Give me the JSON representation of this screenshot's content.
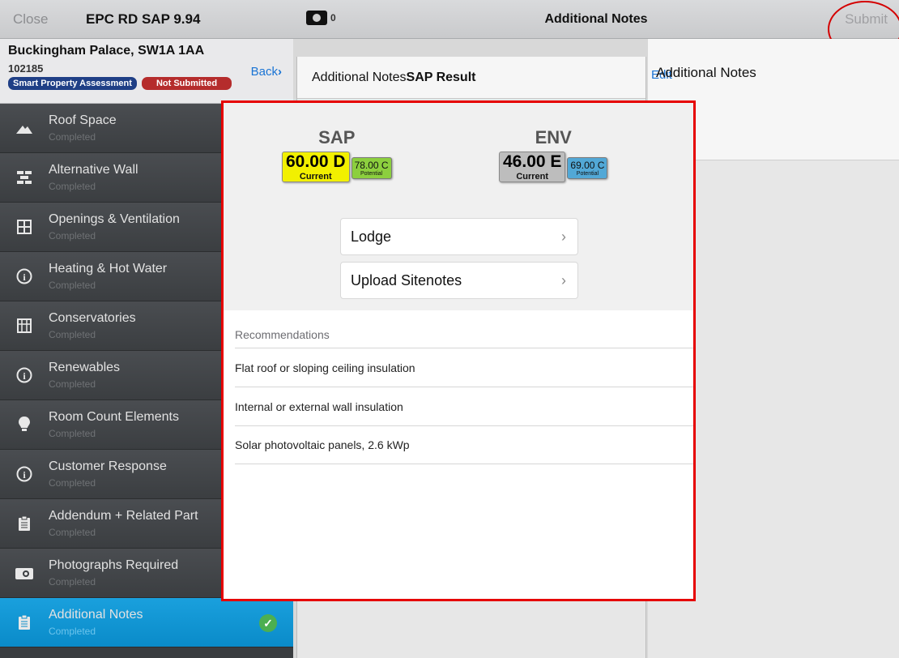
{
  "sidebar": {
    "close_label": "Close",
    "app_title": "EPC RD SAP 9.94",
    "address": "Buckingham Palace, SW1A 1AA",
    "reference": "102185",
    "back_label": "Back",
    "badge_type": "Smart Property Assessment",
    "badge_status": "Not Submitted",
    "items": [
      {
        "label": "Roof Space",
        "status": "Completed",
        "icon": "roof-icon"
      },
      {
        "label": "Alternative Wall",
        "status": "Completed",
        "icon": "brick-wall-icon"
      },
      {
        "label": "Openings & Ventilation",
        "status": "Completed",
        "icon": "window-icon"
      },
      {
        "label": "Heating & Hot Water",
        "status": "Completed",
        "icon": "info-icon"
      },
      {
        "label": "Conservatories",
        "status": "Completed",
        "icon": "conservatory-icon"
      },
      {
        "label": "Renewables",
        "status": "Completed",
        "icon": "info-icon"
      },
      {
        "label": "Room Count Elements",
        "status": "Completed",
        "icon": "bulb-icon"
      },
      {
        "label": "Customer Response",
        "status": "Completed",
        "icon": "info-icon"
      },
      {
        "label": "Addendum + Related Part",
        "status": "Completed",
        "icon": "clipboard-icon"
      },
      {
        "label": "Photographs Required",
        "status": "Completed",
        "icon": "camera-icon"
      },
      {
        "label": "Additional Notes",
        "status": "Completed",
        "icon": "clipboard-icon"
      }
    ]
  },
  "header": {
    "photo_count": "0",
    "title": "Additional Notes",
    "submit_label": "Submit"
  },
  "left_pane": {
    "title_a": "Additional Notes",
    "title_b": "SAP Result"
  },
  "right_pane": {
    "edit_label": "Edit",
    "title": "Additional Notes"
  },
  "modal": {
    "sap": {
      "title": "SAP",
      "current_value": "60.00 D",
      "current_caption": "Current",
      "potential_value": "78.00 C",
      "potential_caption": "Potential"
    },
    "env": {
      "title": "ENV",
      "current_value": "46.00 E",
      "current_caption": "Current",
      "potential_value": "69.00 C",
      "potential_caption": "Potential"
    },
    "actions": {
      "lodge": "Lodge",
      "upload": "Upload Sitenotes"
    },
    "recommendations_header": "Recommendations",
    "recommendations": [
      "Flat roof or sloping ceiling insulation",
      "Internal or external wall insulation",
      "Solar photovoltaic panels, 2.6 kWp"
    ]
  },
  "colors": {
    "sap_current": "#f2f000",
    "sap_potential": "#8ccf3e",
    "env_current": "#bdbdbd",
    "env_potential": "#52a8d6",
    "active_item": "#0a8bc9",
    "highlight": "#e60000"
  }
}
